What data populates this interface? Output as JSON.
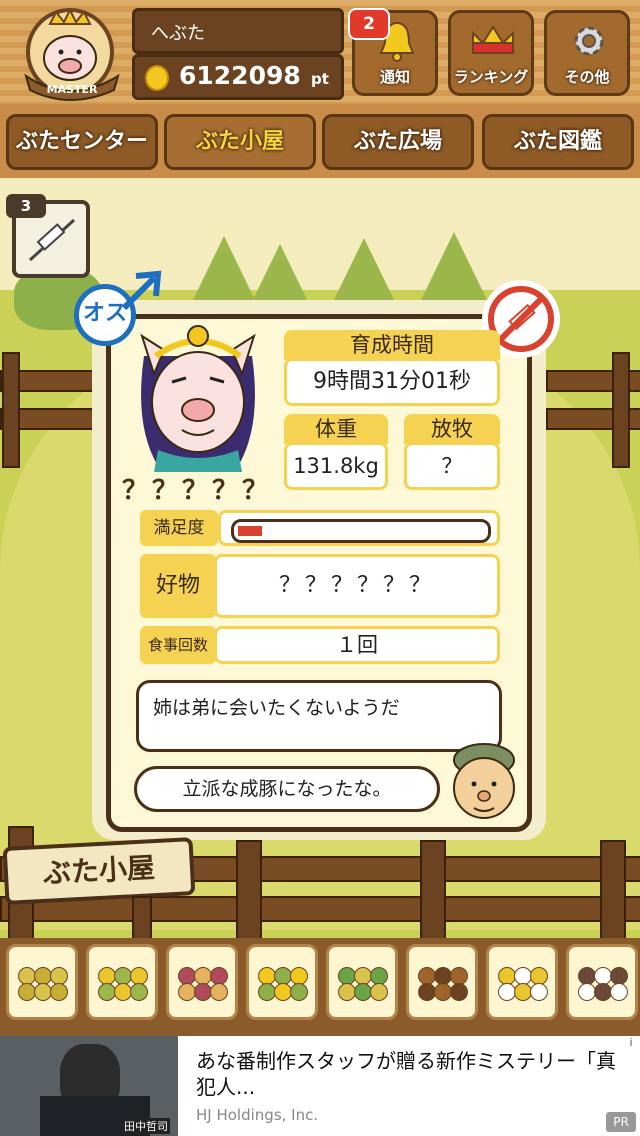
{
  "header": {
    "player_name": "へぶた",
    "points_value": "6122098",
    "points_unit": "pt",
    "notification_count": "2",
    "buttons": {
      "notifications": "通知",
      "ranking": "ランキング",
      "other": "その他"
    },
    "badge_text": "MASTER"
  },
  "tabs": [
    "ぶたセンター",
    "ぶた小屋",
    "ぶた広場",
    "ぶた図鑑"
  ],
  "active_tab": "ぶた小屋",
  "item": {
    "count": "3",
    "icon": "syringe-icon"
  },
  "pig": {
    "gender_label": "オス",
    "name": "？？？？？",
    "labels": {
      "raise_time": "育成時間",
      "weight": "体重",
      "grazing": "放牧",
      "satisfaction": "満足度",
      "favorite": "好物",
      "meal_count": "食事回数"
    },
    "raise_time": "9時間31分01秒",
    "weight": "131.8kg",
    "grazing": "？",
    "satisfaction_level": 0.1,
    "favorite": "？？？？？？",
    "meal_count": "１回"
  },
  "dialog": {
    "message": "姉は弟に会いたくないようだ",
    "farmer_line": "立派な成豚になったな。"
  },
  "sign": "ぶた小屋",
  "food_items": [
    "beans-icon",
    "corn-kernels-icon",
    "sweet-potato-icon",
    "corn-icon",
    "vegetables-icon",
    "acorns-icon",
    "grain-plate-icon",
    "meatballs-plate-icon"
  ],
  "ad": {
    "title": "あな番制作スタッフが贈る新作ミステリー「真犯人...",
    "advertiser": "HJ Holdings, Inc.",
    "pr_label": "PR",
    "caption": "田中哲司",
    "info": "i"
  },
  "colors": {
    "accent_yellow": "#f6d253",
    "wood": "#6b4320",
    "male_blue": "#1e6fc0",
    "alert_red": "#e23a2a"
  }
}
